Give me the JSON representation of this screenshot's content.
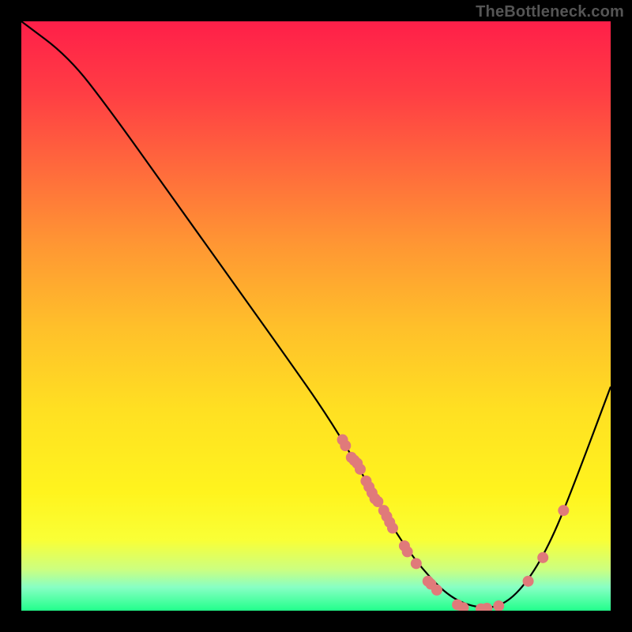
{
  "watermark": "TheBottleneck.com",
  "chart_data": {
    "type": "line",
    "title": "",
    "xlabel": "",
    "ylabel": "",
    "x_range": [
      0,
      100
    ],
    "y_range": [
      0,
      100
    ],
    "curve": [
      {
        "x": 0,
        "y": 100
      },
      {
        "x": 8,
        "y": 94
      },
      {
        "x": 15,
        "y": 85
      },
      {
        "x": 25,
        "y": 71
      },
      {
        "x": 35,
        "y": 57
      },
      {
        "x": 45,
        "y": 43
      },
      {
        "x": 52,
        "y": 33
      },
      {
        "x": 58,
        "y": 23
      },
      {
        "x": 63,
        "y": 14
      },
      {
        "x": 68,
        "y": 7
      },
      {
        "x": 73,
        "y": 2
      },
      {
        "x": 78,
        "y": 0.3
      },
      {
        "x": 82,
        "y": 1
      },
      {
        "x": 86,
        "y": 5
      },
      {
        "x": 90,
        "y": 12
      },
      {
        "x": 94,
        "y": 22
      },
      {
        "x": 100,
        "y": 38
      }
    ],
    "points": [
      {
        "x": 54.5,
        "y": 29
      },
      {
        "x": 55.0,
        "y": 28
      },
      {
        "x": 56.0,
        "y": 26
      },
      {
        "x": 56.5,
        "y": 25.5
      },
      {
        "x": 57.0,
        "y": 25
      },
      {
        "x": 57.5,
        "y": 24
      },
      {
        "x": 58.5,
        "y": 22
      },
      {
        "x": 59.0,
        "y": 21
      },
      {
        "x": 59.5,
        "y": 20
      },
      {
        "x": 60.0,
        "y": 19
      },
      {
        "x": 60.5,
        "y": 18.5
      },
      {
        "x": 61.5,
        "y": 17
      },
      {
        "x": 62.0,
        "y": 16
      },
      {
        "x": 62.5,
        "y": 15
      },
      {
        "x": 63.0,
        "y": 14
      },
      {
        "x": 65.0,
        "y": 11
      },
      {
        "x": 65.5,
        "y": 10
      },
      {
        "x": 67.0,
        "y": 8
      },
      {
        "x": 69.0,
        "y": 5
      },
      {
        "x": 69.5,
        "y": 4.5
      },
      {
        "x": 70.5,
        "y": 3.5
      },
      {
        "x": 74.0,
        "y": 1.0
      },
      {
        "x": 75.0,
        "y": 0.5
      },
      {
        "x": 78.0,
        "y": 0.3
      },
      {
        "x": 79.0,
        "y": 0.4
      },
      {
        "x": 81.0,
        "y": 0.8
      },
      {
        "x": 86.0,
        "y": 5
      },
      {
        "x": 88.5,
        "y": 9
      },
      {
        "x": 92.0,
        "y": 17
      }
    ],
    "point_radius": 7
  }
}
